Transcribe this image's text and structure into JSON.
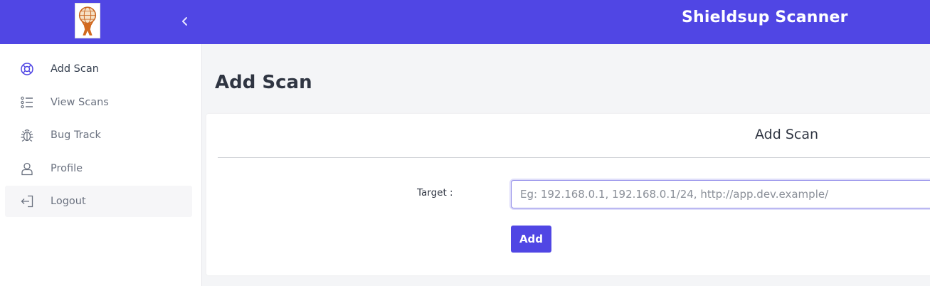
{
  "header": {
    "app_title": "Shieldsup Scanner",
    "logo_icon": "atlas-globe-logo",
    "collapse_icon": "chevron-left-icon",
    "bg_color": "#5046e4"
  },
  "sidebar": {
    "items": [
      {
        "label": "Add Scan",
        "icon": "lifebuoy-icon"
      },
      {
        "label": "View Scans",
        "icon": "list-icon"
      },
      {
        "label": "Bug Track",
        "icon": "bug-icon"
      },
      {
        "label": "Profile",
        "icon": "user-icon"
      },
      {
        "label": "Logout",
        "icon": "logout-icon"
      }
    ]
  },
  "main": {
    "page_title": "Add Scan",
    "card": {
      "title": "Add Scan",
      "target_label": "Target :",
      "target_value": "",
      "target_placeholder": "Eg: 192.168.0.1, 192.168.0.1/24, http://app.dev.example/",
      "submit_label": "Add"
    }
  },
  "colors": {
    "accent": "#5046e4",
    "background": "#f4f5f7"
  }
}
